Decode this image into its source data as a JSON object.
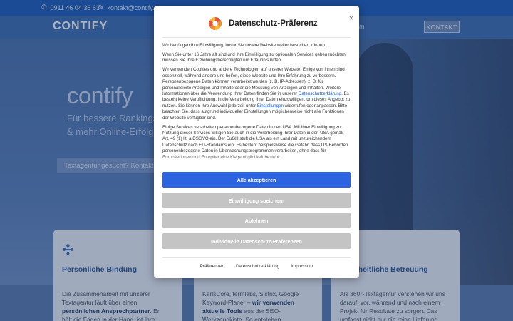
{
  "background": {
    "topbar": {
      "phone": "0911 46 04 36 63",
      "email": "kontakt@contify.de"
    },
    "header": {
      "logo": "CONTIFY",
      "nav_fragment": "m",
      "contact_button": "KONTAKT"
    },
    "hero": {
      "title": "contify",
      "subtitle": "Für bessere Rankings & mehr Online-Erfolg",
      "cta": "Textagentur gesucht? Kontakt"
    },
    "cards": [
      {
        "title": "Persönliche Bindung",
        "text_a": "Die Zusammenarbeit mit unserer Textagentur läuft über einen ",
        "text_bold": "persönlichen Ansprechpartner",
        "text_b": ". Er hält die Fäden in der Hand, ist Ihre Vertrauensperson und Partner"
      },
      {
        "title": "",
        "text_a": "KarlsCore, termlabs, Sistrix, Google Keyword-Planer – ",
        "text_bold": "wir verwenden aktuelle Tools",
        "text_b": " aus der SEO-Werkzeugkiste. So entstehen maßgeschneiderte Lösungen"
      },
      {
        "title": "Ganzheitliche Betreuung",
        "text_a": "Als 360°-Textagentur verstehen wir uns darauf, vor, während und nach einem Projekt für Resultate zu sorgen. Das umfasst nicht nur die reine Lieferung",
        "text_bold": "",
        "text_b": ""
      }
    ]
  },
  "modal": {
    "title": "Datenschutz-Präferenz",
    "close_label": "×",
    "p1": "Wir benötigen Ihre Einwilligung, bevor Sie unsere Website weiter besuchen können.",
    "p2": "Wenn Sie unter 16 Jahre alt sind und Ihre Einwilligung zu optionalen Services geben möchten, müssen Sie Ihre Erziehungsberechtigten um Erlaubnis bitten.",
    "p3_a": "Wir verwenden Cookies und andere Technologien auf unserer Website. Einige von ihnen sind essenziell, während andere uns helfen, diese Website und Ihre Erfahrung zu verbessern. Personenbezogene Daten können verarbeitet werden (z. B. IP-Adressen), z. B. für personalisierte Anzeigen und Inhalte oder die Messung von Anzeigen und Inhalten. Weitere Informationen über die Verwendung Ihrer Daten finden Sie in unserer ",
    "p3_link1": "Datenschutzerklärung",
    "p3_b": ". Es besteht keine Verpflichtung, in die Verarbeitung Ihrer Daten einzuwilligen, um dieses Angebot zu nutzen. Sie können Ihre Auswahl jederzeit unter ",
    "p3_link2": "Einstellungen",
    "p3_c": " widerrufen oder anpassen. Bitte beachten Sie, dass aufgrund individueller Einstellungen möglicherweise nicht alle Funktionen der Website verfügbar sind.",
    "p4": "Einige Services verarbeiten personenbezogene Daten in den USA. Mit Ihrer Einwilligung zur Nutzung dieser Services willigen Sie auch in die Verarbeitung Ihrer Daten in den USA gemäß Art. 49 (1) lit. a DSGVO ein. Der EuGH stuft die USA als ein Land mit unzureichendem Datenschutz nach EU-Standards ein. Es besteht beispielsweise die Gefahr, dass US-Behörden personenbezogene Daten in Überwachungsprogrammen verarbeiten, ohne dass für Europäerinnen und Europäer eine Klagemöglichkeit besteht.",
    "buttons": {
      "accept_all": "Alle akzeptieren",
      "save": "Einwilligung speichern",
      "reject": "Ablehnen",
      "individual": "Individuelle Datenschutz-Präferenzen"
    },
    "footer": {
      "preferences": "Präferenzen",
      "privacy": "Datenschutzerklärung",
      "imprint": "Impressum"
    }
  },
  "colors": {
    "primary": "#2b63e0",
    "secondary": "#c4c4c4",
    "brand": "#3f6fb2"
  }
}
